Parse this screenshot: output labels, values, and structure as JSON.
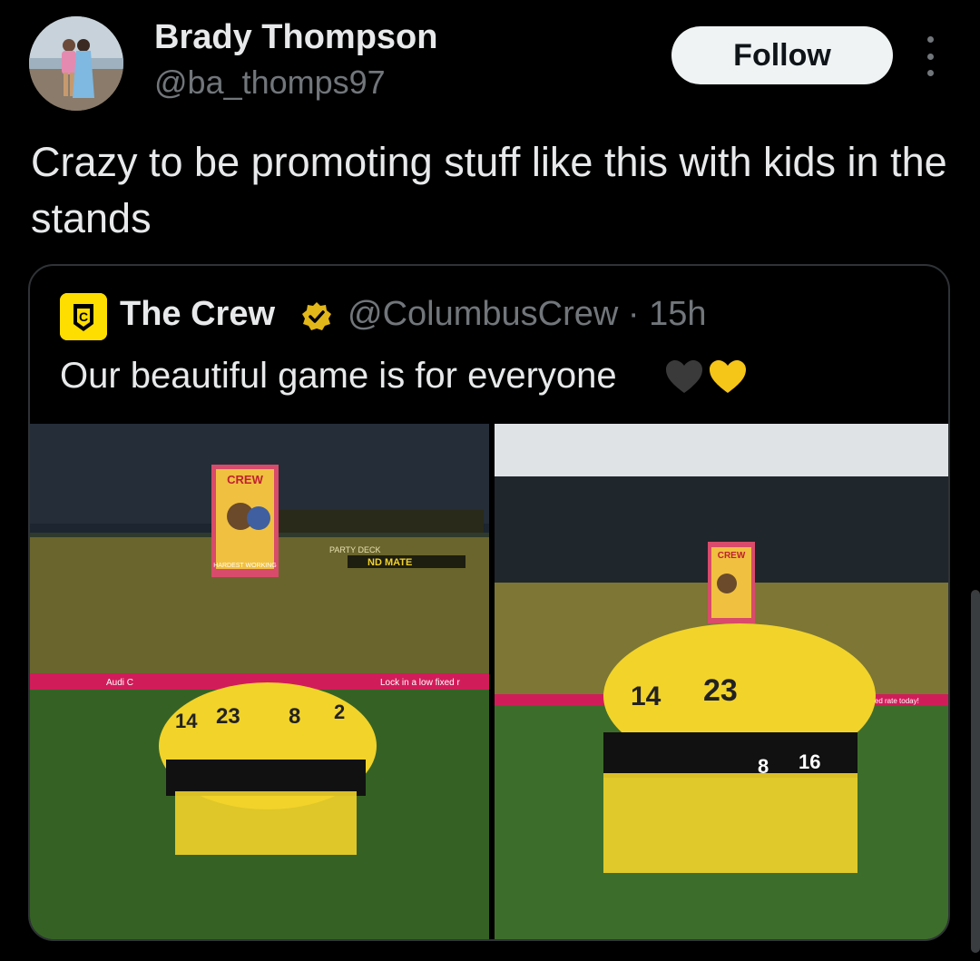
{
  "author": {
    "name": "Brady Thompson",
    "handle": "@ba_thomps97",
    "avatar_icon": "avatar-photo"
  },
  "follow_label": "Follow",
  "more_icon": "more-vertical-icon",
  "tweet": {
    "text": "Crazy to be promoting stuff like this with kids in the stands"
  },
  "quoted": {
    "name": "The Crew",
    "handle_time": "@ColumbusCrew · 15h",
    "text": "Our beautiful game is for everyone",
    "emoji": [
      "black-heart-icon",
      "yellow-heart-icon"
    ],
    "verified_color": "#e2b719",
    "logo_color": "#fedd00",
    "images": {
      "left": {
        "banner": "CREW",
        "banner_sub": "HARDEST WORKING",
        "deck": "PARTY DECK",
        "sign": "ND MATE",
        "ad1": "Audi C",
        "ad2": "Lock in a low fixed r",
        "numbers": [
          "23",
          "8",
          "14",
          "2"
        ]
      },
      "right": {
        "banner": "CREW",
        "ad": "a low fixed rate today!",
        "numbers": [
          "23",
          "14",
          "8",
          "16"
        ]
      }
    }
  },
  "colors": {
    "background": "#000000",
    "text": "#e7e9ea",
    "secondary": "#71767b",
    "border": "#2f3336",
    "kit_yellow": "#f2d32a"
  }
}
